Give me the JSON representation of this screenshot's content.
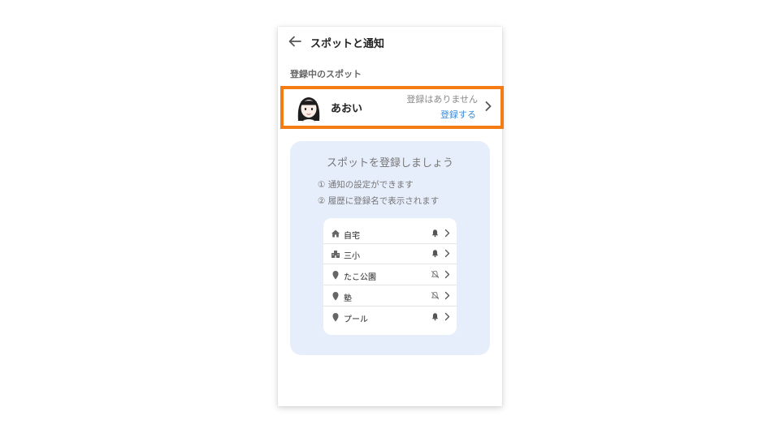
{
  "header": {
    "title": "スポットと通知",
    "back_icon": "arrow-left-icon"
  },
  "section": {
    "label": "登録中のスポット"
  },
  "spot": {
    "name": "あおい",
    "status": "登録はありません",
    "register_link": "登録する",
    "avatar_icon": "girl-avatar"
  },
  "promo": {
    "title": "スポットを登録しましょう",
    "line1": "① 通知の設定ができます",
    "line2": "② 履歴に登録名で表示されます"
  },
  "example_list": [
    {
      "label": "自宅",
      "icon": "home-icon",
      "notification": "on"
    },
    {
      "label": "三小",
      "icon": "school-icon",
      "notification": "on"
    },
    {
      "label": "たこ公園",
      "icon": "pin-icon",
      "notification": "off"
    },
    {
      "label": "塾",
      "icon": "pin-icon",
      "notification": "off"
    },
    {
      "label": "プール",
      "icon": "pin-icon",
      "notification": "on"
    }
  ],
  "colors": {
    "highlight": "#f57c14",
    "link": "#3a8bd9",
    "promo_bg": "#e6edfb"
  }
}
